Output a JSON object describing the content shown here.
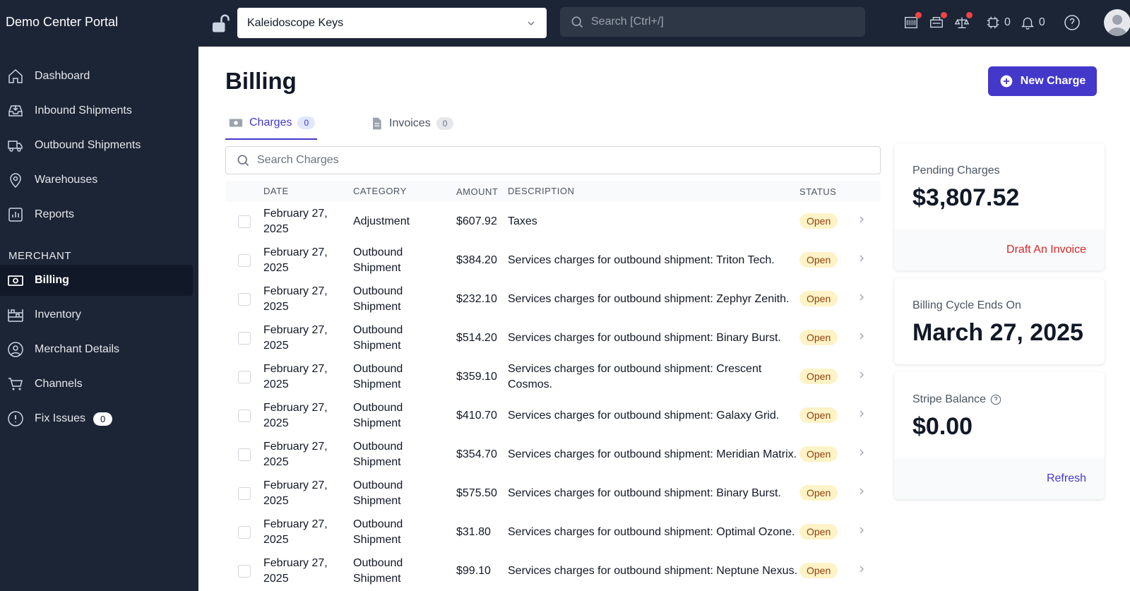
{
  "app_title": "Demo Center Portal",
  "account_select": {
    "value": "Kaleidoscope Keys"
  },
  "global_search": {
    "placeholder": "Search [Ctrl+/]"
  },
  "top_icons": {
    "tasks_count": "0",
    "notifications_count": "0"
  },
  "sidebar": {
    "items": [
      {
        "label": "Dashboard",
        "icon": "home-icon"
      },
      {
        "label": "Inbound Shipments",
        "icon": "inbox-icon"
      },
      {
        "label": "Outbound Shipments",
        "icon": "truck-icon"
      },
      {
        "label": "Warehouses",
        "icon": "location-pin-icon"
      },
      {
        "label": "Reports",
        "icon": "bar-chart-icon"
      }
    ],
    "section_label": "MERCHANT",
    "merchant_items": [
      {
        "label": "Billing",
        "icon": "cash-icon",
        "active": true
      },
      {
        "label": "Inventory",
        "icon": "shelves-icon"
      },
      {
        "label": "Merchant Details",
        "icon": "user-circle-icon"
      },
      {
        "label": "Channels",
        "icon": "cart-icon"
      },
      {
        "label": "Fix Issues",
        "icon": "alert-circle-icon",
        "badge": "0"
      }
    ]
  },
  "page": {
    "title": "Billing",
    "new_charge_label": "New Charge",
    "tabs": [
      {
        "label": "Charges",
        "count": "0"
      },
      {
        "label": "Invoices",
        "count": "0"
      }
    ],
    "search_placeholder": "Search Charges",
    "columns": [
      "DATE",
      "CATEGORY",
      "AMOUNT",
      "DESCRIPTION",
      "STATUS"
    ],
    "rows": [
      {
        "date1": "February 27,",
        "date2": "2025",
        "cat1": "Adjustment",
        "cat2": "",
        "amount": "$607.92",
        "desc": "Taxes",
        "status": "Open"
      },
      {
        "date1": "February 27,",
        "date2": "2025",
        "cat1": "Outbound",
        "cat2": "Shipment",
        "amount": "$384.20",
        "desc": "Services charges for outbound shipment: Triton Tech.",
        "status": "Open"
      },
      {
        "date1": "February 27,",
        "date2": "2025",
        "cat1": "Outbound",
        "cat2": "Shipment",
        "amount": "$232.10",
        "desc": "Services charges for outbound shipment: Zephyr Zenith.",
        "status": "Open"
      },
      {
        "date1": "February 27,",
        "date2": "2025",
        "cat1": "Outbound",
        "cat2": "Shipment",
        "amount": "$514.20",
        "desc": "Services charges for outbound shipment: Binary Burst.",
        "status": "Open"
      },
      {
        "date1": "February 27,",
        "date2": "2025",
        "cat1": "Outbound",
        "cat2": "Shipment",
        "amount": "$359.10",
        "desc": "Services charges for outbound shipment: Crescent Cosmos.",
        "status": "Open"
      },
      {
        "date1": "February 27,",
        "date2": "2025",
        "cat1": "Outbound",
        "cat2": "Shipment",
        "amount": "$410.70",
        "desc": "Services charges for outbound shipment: Galaxy Grid.",
        "status": "Open"
      },
      {
        "date1": "February 27,",
        "date2": "2025",
        "cat1": "Outbound",
        "cat2": "Shipment",
        "amount": "$354.70",
        "desc": "Services charges for outbound shipment: Meridian Matrix.",
        "status": "Open"
      },
      {
        "date1": "February 27,",
        "date2": "2025",
        "cat1": "Outbound",
        "cat2": "Shipment",
        "amount": "$575.50",
        "desc": "Services charges for outbound shipment: Binary Burst.",
        "status": "Open"
      },
      {
        "date1": "February 27,",
        "date2": "2025",
        "cat1": "Outbound",
        "cat2": "Shipment",
        "amount": "$31.80",
        "desc": "Services charges for outbound shipment: Optimal Ozone.",
        "status": "Open"
      },
      {
        "date1": "February 27,",
        "date2": "2025",
        "cat1": "Outbound",
        "cat2": "Shipment",
        "amount": "$99.10",
        "desc": "Services charges for outbound shipment: Neptune Nexus.",
        "status": "Open"
      }
    ]
  },
  "cards": {
    "pending": {
      "label": "Pending Charges",
      "value": "$3,807.52",
      "action": "Draft An Invoice"
    },
    "cycle": {
      "label": "Billing Cycle Ends On",
      "value": "March 27, 2025"
    },
    "stripe": {
      "label": "Stripe Balance",
      "value": "$0.00",
      "action": "Refresh"
    }
  },
  "colors": {
    "sidebar_bg": "#1c2536",
    "accent": "#4338ca",
    "danger": "#dc2626",
    "status_bg": "#fef3c7"
  }
}
